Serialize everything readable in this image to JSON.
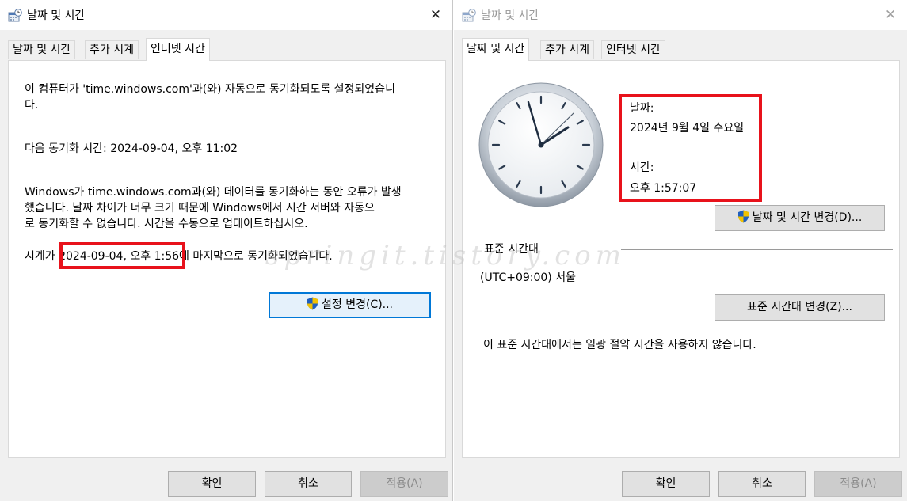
{
  "watermark": "springit.tistory.com",
  "left_dialog": {
    "title": "날짜 및 시간",
    "tabs": [
      "날짜 및 시간",
      "추가 시계",
      "인터넷 시간"
    ],
    "active_tab": 2,
    "sync_line1": "이 컴퓨터가 'time.windows.com'과(와) 자동으로 동기화되도록 설정되었습니",
    "sync_line2": "다.",
    "next_sync": "다음 동기화 시간: 2024-09-04, 오후 11:02",
    "error_line1": "Windows가 time.windows.com과(와) 데이터를 동기화하는 동안 오류가 발생",
    "error_line2": "했습니다. 날짜 차이가 너무 크기 때문에 Windows에서 시간 서버와 자동으",
    "error_line3": "로 동기화할 수 없습니다. 시간을 수동으로 업데이트하십시오.",
    "last_sync_prefix": "시계가 ",
    "last_sync_value": "2024-09-04, 오후 1:56",
    "last_sync_suffix": "에 마지막으로 동기화되었습니다.",
    "change_settings_label": "설정 변경(C)...",
    "ok_label": "확인",
    "cancel_label": "취소",
    "apply_label": "적용(A)"
  },
  "right_dialog": {
    "title": "날짜 및 시간",
    "tabs": [
      "날짜 및 시간",
      "추가 시계",
      "인터넷 시간"
    ],
    "active_tab": 0,
    "date_label": "날짜:",
    "date_value": "2024년 9월 4일 수요일",
    "time_label": "시간:",
    "time_value": "오후 1:57:07",
    "change_datetime_label": "날짜 및 시간 변경(D)...",
    "timezone_header": "표준 시간대",
    "timezone_value": "(UTC+09:00) 서울",
    "change_timezone_label": "표준 시간대 변경(Z)...",
    "dst_note": "이 표준 시간대에서는 일광 절약 시간을 사용하지 않습니다.",
    "ok_label": "확인",
    "cancel_label": "취소",
    "apply_label": "적용(A)"
  },
  "colors": {
    "highlight_border": "#e8121b",
    "focus_border": "#0078d7"
  }
}
